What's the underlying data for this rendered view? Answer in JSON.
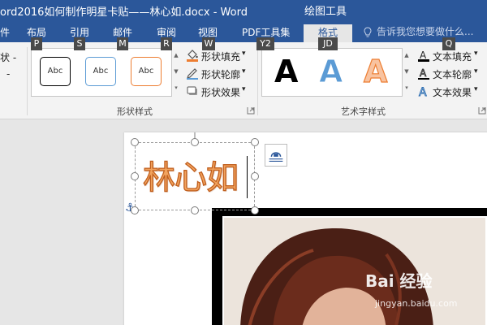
{
  "window": {
    "title": "ord2016如何制作明星卡贴——林心如.docx - Word",
    "context_label": "绘图工具"
  },
  "tabs": [
    {
      "label": "件"
    },
    {
      "label": "布局"
    },
    {
      "label": "引用"
    },
    {
      "label": "邮件"
    },
    {
      "label": "审阅"
    },
    {
      "label": "视图"
    },
    {
      "label": "PDF工具集"
    }
  ],
  "active_tab": {
    "label": "格式"
  },
  "tell_me": {
    "placeholder": "告诉我您想要做什么..."
  },
  "keytips": [
    "P",
    "S",
    "M",
    "R",
    "W",
    "Y2",
    "JD",
    "Q"
  ],
  "ribbon": {
    "left_cut_items": [
      "状 -",
      "-"
    ],
    "shape_styles": {
      "gallery": [
        "Abc",
        "Abc",
        "Abc"
      ],
      "fill_label": "形状填充",
      "outline_label": "形状轮廓",
      "effects_label": "形状效果",
      "group_label": "形状样式"
    },
    "wordart_styles": {
      "gallery": [
        "A",
        "A",
        "A"
      ],
      "text_fill_label": "文本填充",
      "text_outline_label": "文本轮廓",
      "text_effects_label": "文本效果",
      "group_label": "艺术字样式"
    }
  },
  "document": {
    "textbox_text": "林心如",
    "watermark": "Bai 经验",
    "watermark_url": "jingyan.baidu.com"
  },
  "colors": {
    "ribbon_blue": "#2b579a",
    "wordart_orange": "#f2a35e",
    "wordart_outline": "#c05e1d",
    "style_black": "#000000",
    "style_blue": "#5b9bd5",
    "style_orange": "#ed7d31"
  }
}
